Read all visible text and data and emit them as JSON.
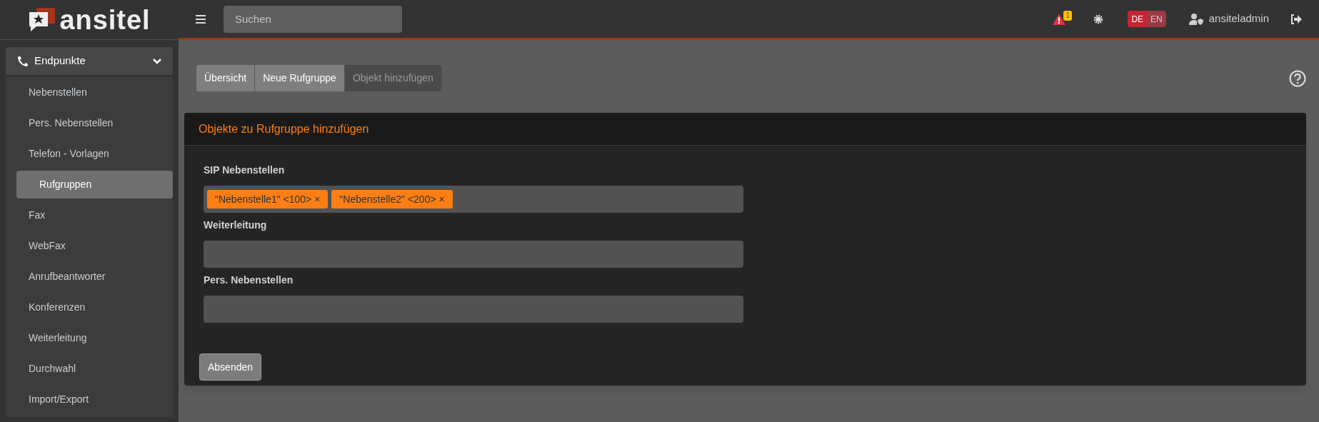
{
  "logo": {
    "text": "ansitel"
  },
  "search": {
    "placeholder": "Suchen"
  },
  "topbar": {
    "alert_count": "1",
    "languages": [
      {
        "label": "DE",
        "selected": true
      },
      {
        "label": "EN",
        "selected": false
      }
    ],
    "user": "ansiteladmin"
  },
  "sidebar": {
    "group": {
      "label": "Endpunkte",
      "expanded": true
    },
    "items": [
      {
        "label": "Nebenstellen",
        "selected": false
      },
      {
        "label": "Pers. Nebenstellen",
        "selected": false
      },
      {
        "label": "Telefon - Vorlagen",
        "selected": false
      },
      {
        "label": "Rufgruppen",
        "selected": true
      },
      {
        "label": "Fax",
        "selected": false
      },
      {
        "label": "WebFax",
        "selected": false
      },
      {
        "label": "Anrufbeantworter",
        "selected": false
      },
      {
        "label": "Konferenzen",
        "selected": false
      },
      {
        "label": "Weiterleitung",
        "selected": false
      },
      {
        "label": "Durchwahl",
        "selected": false
      },
      {
        "label": "Import/Export",
        "selected": false
      }
    ]
  },
  "breadcrumb": [
    {
      "label": "Übersicht",
      "selected": false
    },
    {
      "label": "Neue Rufgruppe",
      "selected": false
    },
    {
      "label": "Objekt hinzufügen",
      "selected": true
    }
  ],
  "card": {
    "title": "Objekte zu Rufgruppe hinzufügen",
    "fields": [
      {
        "label": "SIP Nebenstellen",
        "tags": [
          "\"Nebenstelle1\" <100> ×",
          "\"Nebenstelle2\" <200> ×"
        ]
      },
      {
        "label": "Weiterleitung"
      },
      {
        "label": "Pers. Nebenstellen"
      }
    ],
    "submit": "Absenden"
  }
}
